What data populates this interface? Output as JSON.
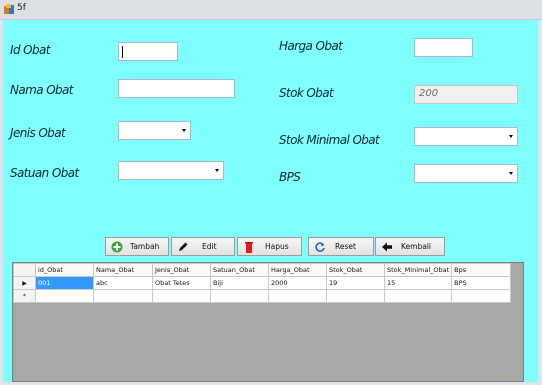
{
  "window": {
    "title": "5f"
  },
  "form": {
    "id_obat_label": "Id Obat",
    "nama_obat_label": "Nama Obat",
    "jenis_obat_label": "Jenis Obat",
    "satuan_obat_label": "Satuan Obat",
    "harga_obat_label": "Harga Obat",
    "stok_obat_label": "Stok Obat",
    "stok_minimal_label": "Stok Minimal Obat",
    "bps_label": "BPS",
    "id_obat_value": "",
    "nama_obat_value": "",
    "harga_obat_value": "",
    "stok_obat_value": "200"
  },
  "buttons": {
    "tambah": "Tambah",
    "edit": "Edit",
    "hapus": "Hapus",
    "reset": "Reset",
    "kembali": "Kembali"
  },
  "grid": {
    "columns": [
      "id_Obat",
      "Nama_Obat",
      "Jenis_Obat",
      "Satuan_Obat",
      "Harga_Obat",
      "Stok_Obat",
      "Stok_Minimal_Obat",
      "Bps"
    ],
    "rows": [
      [
        "001",
        "abc",
        "Obat Tetes",
        "Biji",
        "2000",
        "19",
        "15",
        "BPS"
      ]
    ],
    "row_marker": "▶",
    "new_row_marker": "*"
  },
  "colors": {
    "client_bg": "#7ffefe",
    "selection": "#3399ff"
  }
}
